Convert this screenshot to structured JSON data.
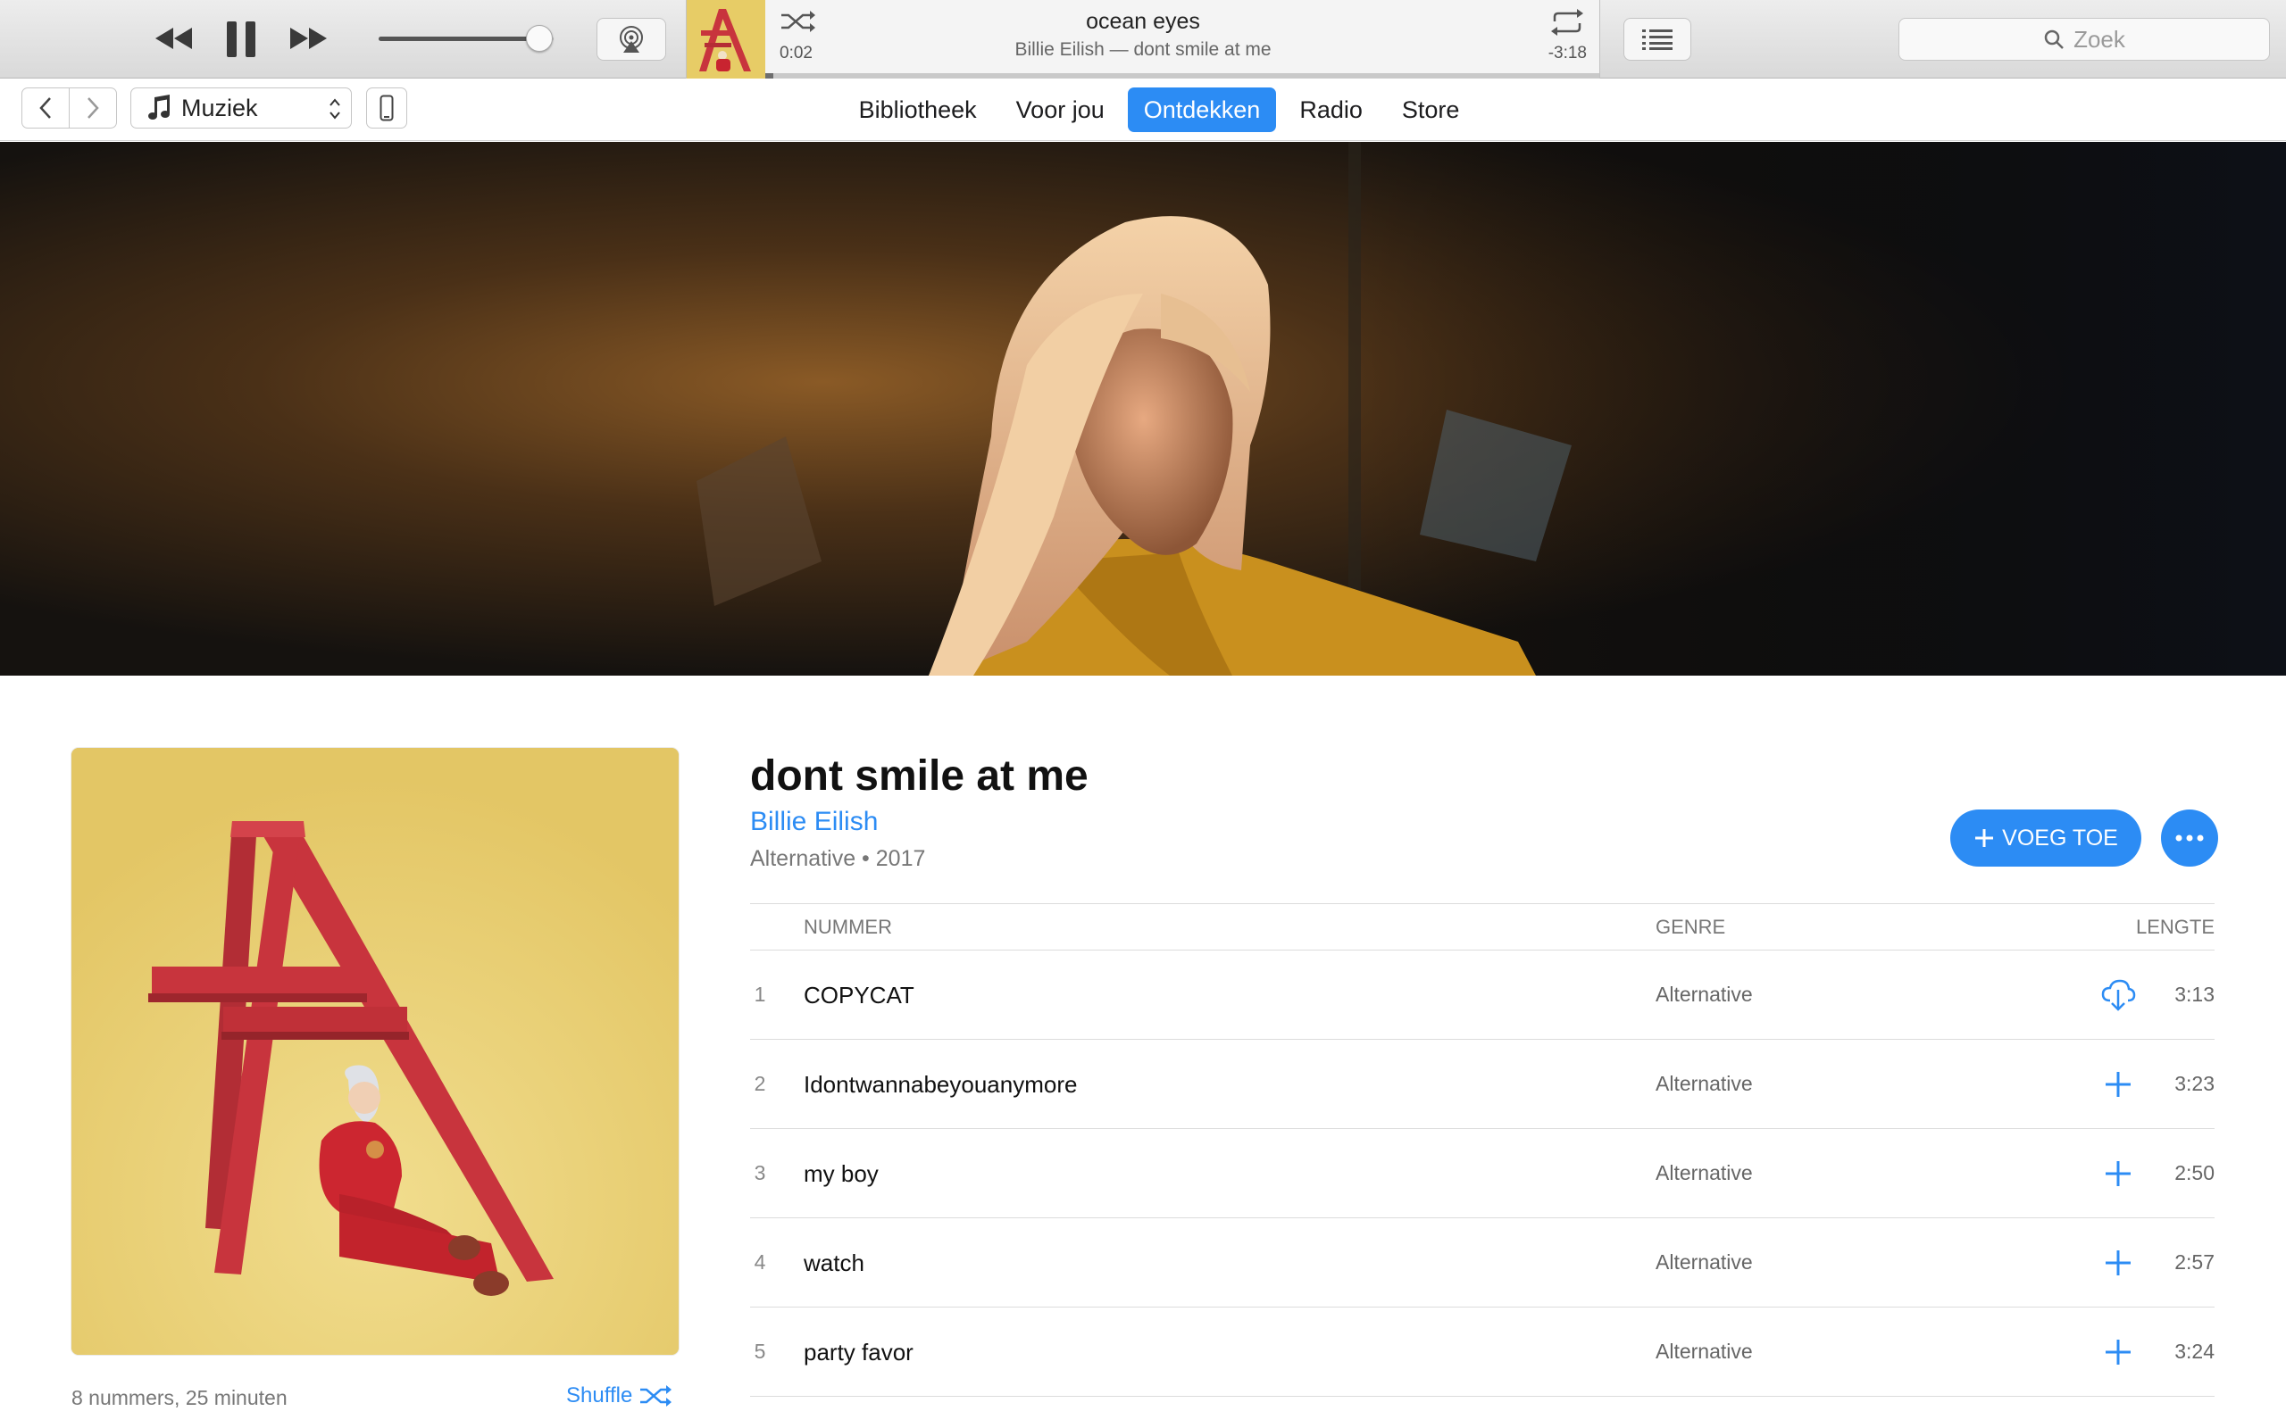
{
  "player": {
    "track_title": "ocean eyes",
    "track_subtitle": "Billie Eilish — dont smile at me",
    "time_elapsed": "0:02",
    "time_remaining": "-3:18",
    "progress": 0.01,
    "volume": 0.92
  },
  "search": {
    "placeholder": "Zoek"
  },
  "nav": {
    "media_select": "Muziek",
    "tabs": [
      {
        "label": "Bibliotheek",
        "active": false
      },
      {
        "label": "Voor jou",
        "active": false
      },
      {
        "label": "Ontdekken",
        "active": true
      },
      {
        "label": "Radio",
        "active": false
      },
      {
        "label": "Store",
        "active": false
      }
    ]
  },
  "album": {
    "title": "dont smile at me",
    "artist": "Billie Eilish",
    "genre_year": "Alternative • 2017",
    "meta": "8 nummers, 25 minuten",
    "shuffle_label": "Shuffle",
    "add_label": "VOEG TOE"
  },
  "tracklist": {
    "headers": {
      "title": "NUMMER",
      "genre": "GENRE",
      "length": "LENGTE"
    },
    "tracks": [
      {
        "number": "1",
        "title": "COPYCAT",
        "genre": "Alternative",
        "length": "3:13",
        "action": "download-icon"
      },
      {
        "number": "2",
        "title": "Idontwannabeyouanymore",
        "genre": "Alternative",
        "length": "3:23",
        "action": "plus-icon"
      },
      {
        "number": "3",
        "title": "my boy",
        "genre": "Alternative",
        "length": "2:50",
        "action": "plus-icon"
      },
      {
        "number": "4",
        "title": "watch",
        "genre": "Alternative",
        "length": "2:57",
        "action": "plus-icon"
      },
      {
        "number": "5",
        "title": "party favor",
        "genre": "Alternative",
        "length": "3:24",
        "action": "plus-icon"
      }
    ]
  },
  "colors": {
    "accent": "#2c8cf4",
    "album_background": "#ead37a",
    "ladder_red": "#c8343d"
  }
}
